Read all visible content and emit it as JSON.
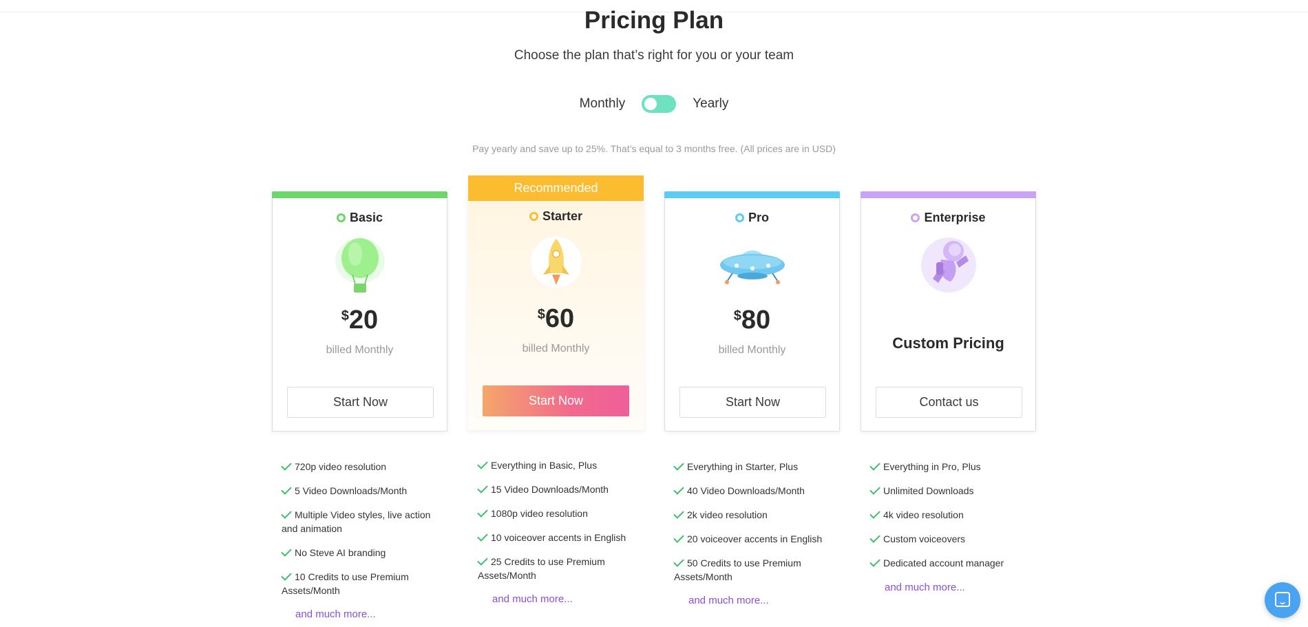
{
  "header": {
    "title": "Pricing Plan",
    "subtitle": "Choose the plan that’s right for you or your team"
  },
  "billing": {
    "monthly_label": "Monthly",
    "yearly_label": "Yearly",
    "selected": "Monthly",
    "note": "Pay yearly and save up to 25%. That’s equal to 3 months free. (All prices are in USD)"
  },
  "plans": [
    {
      "name": "Basic",
      "accent_color": "#6ed66b",
      "icon": "hot-air-balloon-illustration",
      "currency": "$",
      "price": "20",
      "billed": "billed Monthly",
      "cta": "Start Now",
      "features": [
        "720p video resolution",
        "5 Video Downloads/Month",
        "Multiple Video styles, live action and animation",
        "No Steve AI branding",
        "10 Credits to use Premium Assets/Month"
      ],
      "more": "and much more..."
    },
    {
      "name": "Starter",
      "badge": "Recommended",
      "accent_color": "#fbbc30",
      "icon": "rocket-illustration",
      "currency": "$",
      "price": "60",
      "billed": "billed Monthly",
      "cta": "Start Now",
      "features": [
        "Everything in Basic, Plus",
        "15 Video Downloads/Month",
        "1080p video resolution",
        "10 voiceover accents in English",
        "25 Credits to use Premium Assets/Month"
      ],
      "more": "and much more..."
    },
    {
      "name": "Pro",
      "accent_color": "#5bcdf2",
      "icon": "ufo-illustration",
      "currency": "$",
      "price": "80",
      "billed": "billed Monthly",
      "cta": "Start Now",
      "features": [
        "Everything in Starter, Plus",
        "40 Video Downloads/Month",
        "2k video resolution",
        "20 voiceover accents in English",
        "50 Credits to use Premium Assets/Month"
      ],
      "more": "and much more..."
    },
    {
      "name": "Enterprise",
      "accent_color": "#c9a3f5",
      "icon": "astronaut-illustration",
      "custom_price": "Custom Pricing",
      "cta": "Contact us",
      "features": [
        "Everything in Pro, Plus",
        "Unlimited Downloads",
        "4k video resolution",
        "Custom voiceovers",
        "Dedicated account manager"
      ],
      "more": "and much more..."
    }
  ],
  "chat": {
    "icon": "chat-icon"
  }
}
